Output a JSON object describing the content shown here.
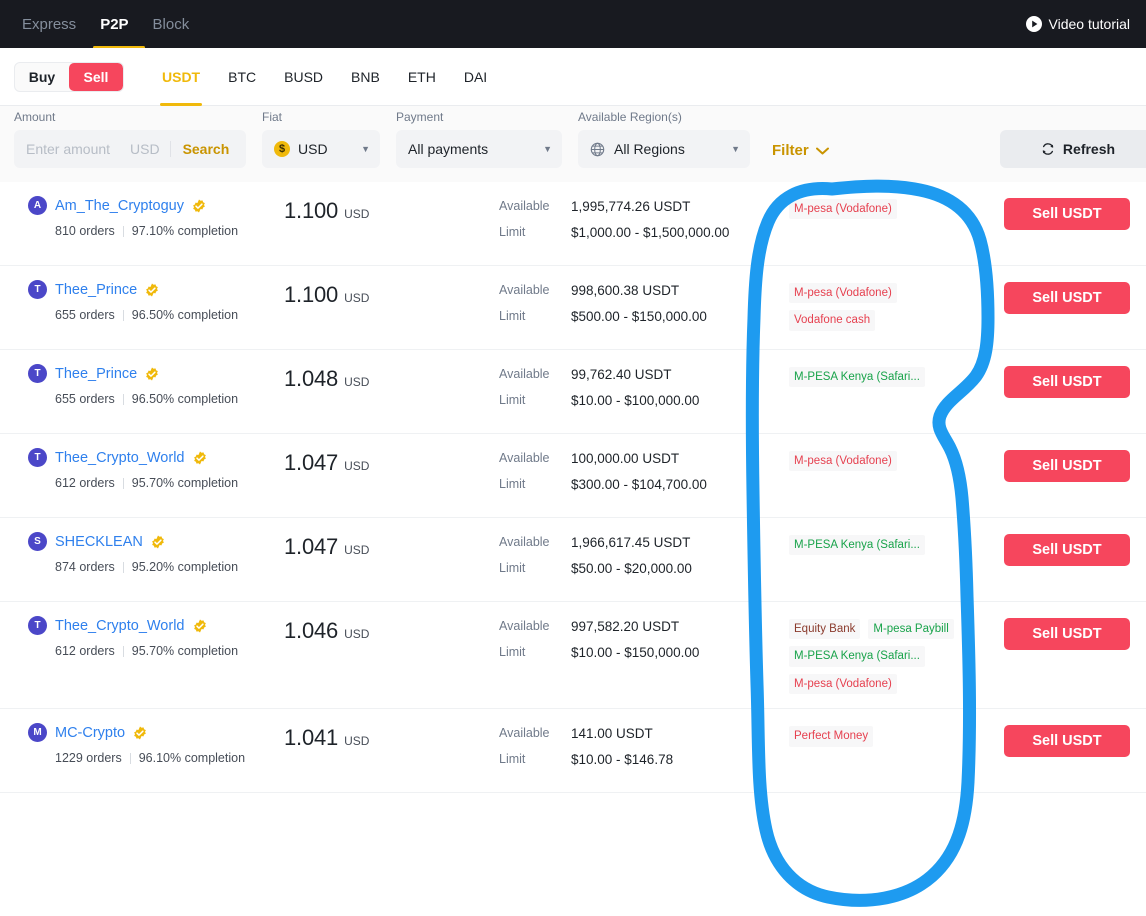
{
  "topnav": {
    "tabs": [
      {
        "label": "Express",
        "active": false
      },
      {
        "label": "P2P",
        "active": true
      },
      {
        "label": "Block",
        "active": false
      }
    ],
    "video_tutorial": "Video tutorial",
    "video_icon": "play-circle-icon"
  },
  "subbar": {
    "buy_label": "Buy",
    "sell_label": "Sell",
    "coin_tabs": [
      {
        "label": "USDT",
        "active": true
      },
      {
        "label": "BTC",
        "active": false
      },
      {
        "label": "BUSD",
        "active": false
      },
      {
        "label": "BNB",
        "active": false
      },
      {
        "label": "ETH",
        "active": false
      },
      {
        "label": "DAI",
        "active": false
      }
    ]
  },
  "filters": {
    "amount_label": "Amount",
    "amount_placeholder": "Enter amount",
    "amount_value": "",
    "amount_currency": "USD",
    "search_label": "Search",
    "fiat_label": "Fiat",
    "fiat_value": "USD",
    "fiat_coin_glyph": "$",
    "payment_label": "Payment",
    "payment_value": "All payments",
    "region_label": "Available Region(s)",
    "region_value": "All Regions",
    "region_icon": "globe-icon",
    "filter_label": "Filter",
    "filter_caret": "chevron-down-icon",
    "refresh_label": "Refresh",
    "refresh_icon": "refresh-icon",
    "caret": "▼"
  },
  "table": {
    "available_label": "Available",
    "limit_label": "Limit",
    "action_label": "Sell USDT",
    "rows": [
      {
        "avatar_letter": "A",
        "name": "Am_The_Cryptoguy",
        "verified": true,
        "orders": "810 orders",
        "completion": "97.10% completion",
        "price": "1.100",
        "price_currency": "USD",
        "available": "1,995,774.26 USDT",
        "limit": "$1,000.00 - $1,500,000.00",
        "payments": [
          {
            "label": "M-pesa (Vodafone)",
            "color": "red"
          }
        ]
      },
      {
        "avatar_letter": "T",
        "name": "Thee_Prince",
        "verified": true,
        "orders": "655 orders",
        "completion": "96.50% completion",
        "price": "1.100",
        "price_currency": "USD",
        "available": "998,600.38 USDT",
        "limit": "$500.00 - $150,000.00",
        "payments": [
          {
            "label": "M-pesa (Vodafone)",
            "color": "red"
          },
          {
            "label": "Vodafone cash",
            "color": "red"
          }
        ]
      },
      {
        "avatar_letter": "T",
        "name": "Thee_Prince",
        "verified": true,
        "orders": "655 orders",
        "completion": "96.50% completion",
        "price": "1.048",
        "price_currency": "USD",
        "available": "99,762.40 USDT",
        "limit": "$10.00 - $100,000.00",
        "payments": [
          {
            "label": "M-PESA Kenya (Safari...",
            "color": "green"
          }
        ]
      },
      {
        "avatar_letter": "T",
        "name": "Thee_Crypto_World",
        "verified": true,
        "orders": "612 orders",
        "completion": "95.70% completion",
        "price": "1.047",
        "price_currency": "USD",
        "available": "100,000.00 USDT",
        "limit": "$300.00 - $104,700.00",
        "payments": [
          {
            "label": "M-pesa (Vodafone)",
            "color": "red"
          }
        ]
      },
      {
        "avatar_letter": "S",
        "name": "SHECKLEAN",
        "verified": true,
        "orders": "874 orders",
        "completion": "95.20% completion",
        "price": "1.047",
        "price_currency": "USD",
        "available": "1,966,617.45 USDT",
        "limit": "$50.00 - $20,000.00",
        "payments": [
          {
            "label": "M-PESA Kenya (Safari...",
            "color": "green"
          }
        ]
      },
      {
        "avatar_letter": "T",
        "name": "Thee_Crypto_World",
        "verified": true,
        "orders": "612 orders",
        "completion": "95.70% completion",
        "price": "1.046",
        "price_currency": "USD",
        "available": "997,582.20 USDT",
        "limit": "$10.00 - $150,000.00",
        "payments": [
          {
            "label": "Equity Bank",
            "color": "brown"
          },
          {
            "label": "M-pesa Paybill",
            "color": "green"
          },
          {
            "label": "M-PESA Kenya (Safari...",
            "color": "green"
          },
          {
            "label": "M-pesa (Vodafone)",
            "color": "red"
          }
        ]
      },
      {
        "avatar_letter": "M",
        "name": "MC-Crypto",
        "verified": true,
        "orders": "1229 orders",
        "completion": "96.10% completion",
        "price": "1.041",
        "price_currency": "USD",
        "available": "141.00 USDT",
        "limit": "$10.00 - $146.78",
        "payments": [
          {
            "label": "Perfect Money",
            "color": "red"
          }
        ]
      }
    ]
  },
  "annotation": {
    "shape": "hand-drawn-circle",
    "color": "#1e9bf0",
    "target": "payment-methods-column"
  },
  "colors": {
    "accent_yellow": "#f0b90b",
    "sell_red": "#f6465d",
    "link_blue": "#2f80ed",
    "dark_nav": "#181a20",
    "annotation_blue": "#1e9bf0"
  }
}
